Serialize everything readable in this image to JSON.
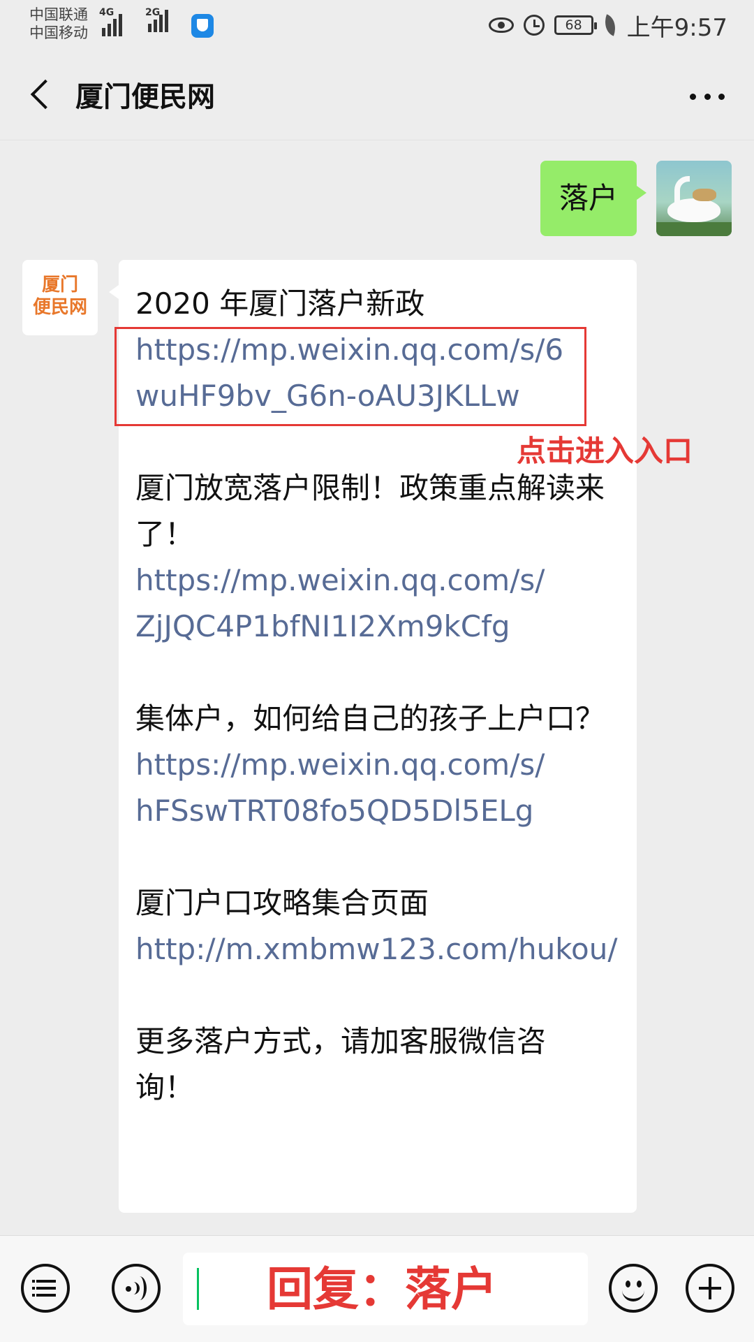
{
  "status_bar": {
    "carrier_1": "中国联通",
    "carrier_2": "中国移动",
    "network_1": "4G",
    "network_2": "2G",
    "battery": "68",
    "time": "上午9:57"
  },
  "header": {
    "title": "厦门便民网"
  },
  "messages": {
    "outgoing": {
      "text": "落户"
    },
    "incoming": {
      "avatar_text_line1": "厦门",
      "avatar_text_line2": "便民网",
      "items": [
        {
          "heading": "2020 年厦门落户新政",
          "link": "https://mp.weixin.qq.com/s/6wuHF9bv_G6n-oAU3JKLLw"
        },
        {
          "heading": "厦门放宽落户限制！政策重点解读来了！",
          "link": "https://mp.weixin.qq.com/s/ZjJQC4P1bfNI1I2Xm9kCfg"
        },
        {
          "heading": "集体户，如何给自己的孩子上户口？",
          "link": "https://mp.weixin.qq.com/s/hFSswTRT08fo5QD5Dl5ELg"
        },
        {
          "heading": "厦门户口攻略集合页面",
          "link": "http://m.xmbmw123.com/hukou/"
        }
      ],
      "footer": "更多落户方式，请加客服微信咨询！"
    }
  },
  "annotations": {
    "click_entry": "点击进入入口",
    "reply_hint": "回复：落户",
    "highlight_color": "#e53935"
  },
  "input_bar": {
    "icons": [
      "menu-icon",
      "voice-icon",
      "emoji-icon",
      "plus-icon"
    ]
  }
}
